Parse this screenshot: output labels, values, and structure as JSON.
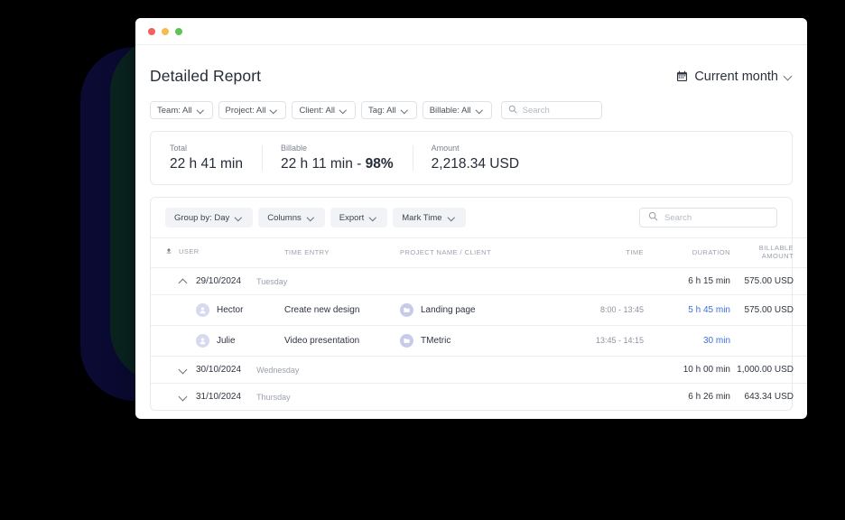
{
  "window": {
    "traffic_lights": [
      "close",
      "minimize",
      "maximize"
    ]
  },
  "header": {
    "title": "Detailed Report",
    "date_range": {
      "icon": "calendar-icon",
      "label": "Current month",
      "chevron": "chevron-down-icon"
    }
  },
  "filters": {
    "pills": [
      {
        "label": "Team: All"
      },
      {
        "label": "Project: All"
      },
      {
        "label": "Client: All"
      },
      {
        "label": "Tag: All"
      },
      {
        "label": "Billable: All"
      }
    ],
    "search": {
      "placeholder": "Search",
      "value": "",
      "icon": "search-icon"
    }
  },
  "summary": {
    "stats": [
      {
        "label": "Total",
        "value": "22 h 41 min",
        "value_bold": ""
      },
      {
        "label": "Billable",
        "value": "22 h 11 min - ",
        "value_bold": "98%"
      },
      {
        "label": "Amount",
        "value": "2,218.34 USD",
        "value_bold": ""
      }
    ]
  },
  "toolbar": {
    "buttons": [
      {
        "label": "Group by: Day"
      },
      {
        "label": "Columns"
      },
      {
        "label": "Export"
      },
      {
        "label": "Mark Time"
      }
    ],
    "search": {
      "placeholder": "Search",
      "value": "",
      "icon": "search-icon"
    }
  },
  "table": {
    "columns": [
      {
        "key": "user",
        "label": "USER",
        "align": "left",
        "sort_icon": "sort-ascending-icon"
      },
      {
        "key": "entry",
        "label": "TIME ENTRY",
        "align": "left"
      },
      {
        "key": "project",
        "label": "PROJECT NAME / CLIENT",
        "align": "left"
      },
      {
        "key": "time",
        "label": "TIME",
        "align": "right"
      },
      {
        "key": "dur",
        "label": "DURATION",
        "align": "right"
      },
      {
        "key": "amount",
        "label": "BILLABLE AMOUNT",
        "align": "right"
      }
    ],
    "rows": [
      {
        "type": "group",
        "expanded": true,
        "chevron": "chevron-up-icon",
        "date": "29/10/2024",
        "day": "Tuesday",
        "duration": "6 h 15 min",
        "amount": "575.00 USD"
      },
      {
        "type": "entry",
        "avatar": "user-avatar-icon",
        "user": "Hector",
        "entry": "Create new design",
        "project_icon": "project-folder-icon",
        "project": "Landing page",
        "time": "8:00 - 13:45",
        "duration": "5 h 45 min",
        "amount": "575.00 USD"
      },
      {
        "type": "entry",
        "avatar": "user-avatar-icon",
        "user": "Julie",
        "entry": "Video presentation",
        "project_icon": "project-folder-icon",
        "project": "TMetric",
        "time": "13:45 - 14:15",
        "duration": "30 min",
        "amount": ""
      },
      {
        "type": "group",
        "expanded": false,
        "chevron": "chevron-down-icon",
        "date": "30/10/2024",
        "day": "Wednesday",
        "duration": "10 h 00 min",
        "amount": "1,000.00 USD"
      },
      {
        "type": "group",
        "expanded": false,
        "chevron": "chevron-down-icon",
        "date": "31/10/2024",
        "day": "Thursday",
        "duration": "6 h 26 min",
        "amount": "643.34 USD"
      }
    ]
  },
  "colors": {
    "accent_blue": "#3b6fe0",
    "text_primary": "#2e343f",
    "text_muted": "#9aa1ad",
    "avatar_bg": "#d7d9ef",
    "project_bg": "#c8cbe8",
    "deco_navy": "#0a0a33",
    "deco_green": "#0a2420",
    "background": "#000000"
  }
}
